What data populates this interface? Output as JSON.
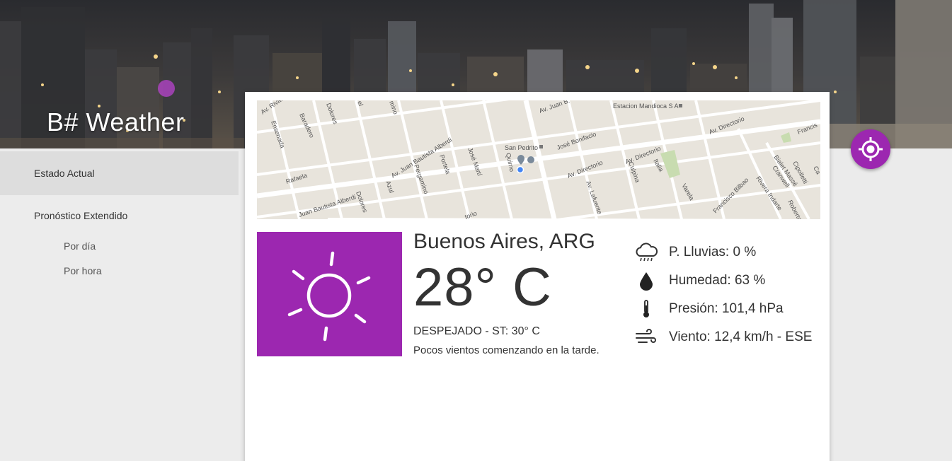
{
  "app": {
    "title": "B# Weather"
  },
  "sidebar": {
    "items": [
      {
        "label": "Estado Actual",
        "active": true
      },
      {
        "label": "Pronóstico Extendido",
        "active": false
      }
    ],
    "subitems": [
      {
        "label": "Por día"
      },
      {
        "label": "Por hora"
      }
    ]
  },
  "map": {
    "streets": [
      "Av. Rivadavia",
      "Baradero",
      "Dolores",
      "Ensenada",
      "Rafaela",
      "Av. Juan Bautista Alberdi",
      "Juan Bautista Alberdi",
      "Pergamino",
      "Portela",
      "José Martí",
      "Azul",
      "Dolores",
      "San Pedrito",
      "Quirno",
      "Av. Juan B.",
      "José Bonifacio",
      "Estacion Mandioca S A",
      "Av. Directorio",
      "Av. Directorio",
      "Av. Directorio",
      "Culpina",
      "Av. Lafuente",
      "Italia",
      "Varela",
      "Francisco Bilbao",
      "Rivera Indarte",
      "Cipolletti",
      "Bialet Massé",
      "Cranwell",
      "Roberto",
      "Francis",
      "Ca",
      "torio",
      "mino",
      "el"
    ]
  },
  "weather": {
    "icon": "sun-icon",
    "city": "Buenos Aires, ARG",
    "temperature": "28° C",
    "condition": "DESPEJADO - ST: 30° C",
    "description": "Pocos vientos comenzando en la tarde.",
    "stats": [
      {
        "icon": "rain-cloud-icon",
        "text": "P. Lluvias: 0 %"
      },
      {
        "icon": "drop-icon",
        "text": "Humedad: 63 %"
      },
      {
        "icon": "thermometer-icon",
        "text": "Presión: 101,4 hPa"
      },
      {
        "icon": "wind-icon",
        "text": "Viento: 12,4 km/h - ESE"
      }
    ]
  },
  "colors": {
    "accent": "#9c27b0",
    "sidebar_bg": "#ececec",
    "active_item_bg": "#dddddd"
  },
  "fab": {
    "icon": "locate-icon"
  }
}
